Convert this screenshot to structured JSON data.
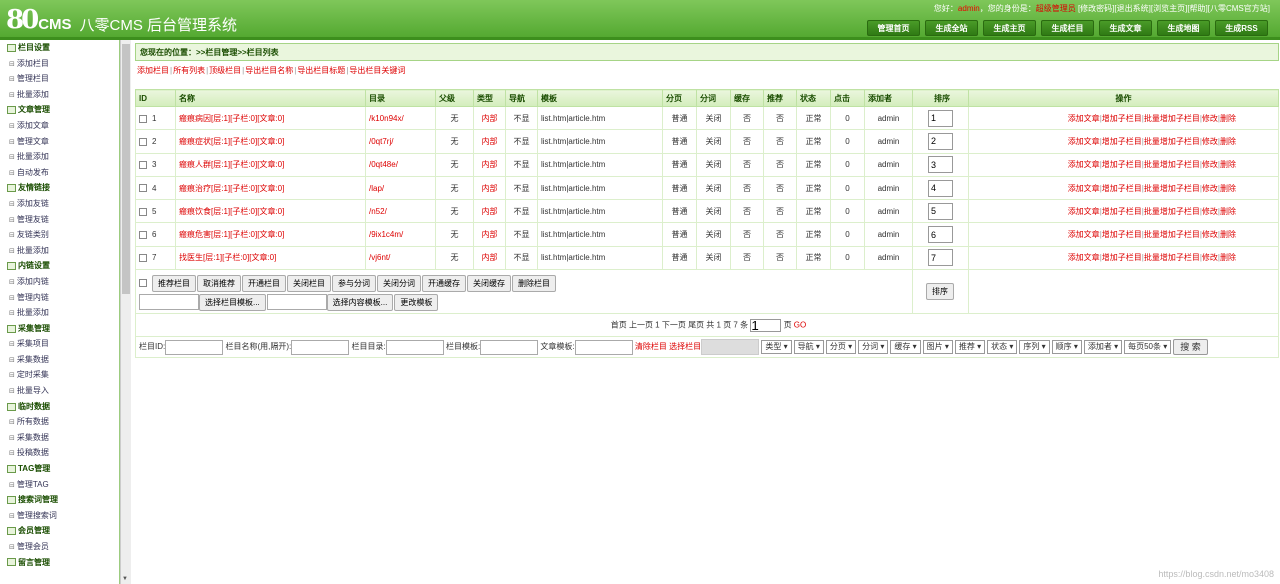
{
  "header": {
    "logo_mark": "80",
    "logo_cms": "CMS",
    "logo_title": "八零CMS 后台管理系统",
    "greeting": "您好：",
    "user": "admin",
    "identity_label": "，您的身份是：",
    "identity": "超级管理员",
    "links": [
      "[修改密码]",
      "[退出系统]",
      "[浏览主页]",
      "[帮助]",
      "[八零CMS官方站]"
    ],
    "nav": [
      "管理首页",
      "生成全站",
      "生成主页",
      "生成栏目",
      "生成文章",
      "生成地图",
      "生成RSS"
    ]
  },
  "sidebar": [
    {
      "group": "栏目设置",
      "items": [
        "添加栏目",
        "管理栏目",
        "批量添加"
      ]
    },
    {
      "group": "文章管理",
      "items": [
        "添加文章",
        "管理文章",
        "批量添加",
        "自动发布"
      ]
    },
    {
      "group": "友情链接",
      "items": [
        "添加友链",
        "管理友链",
        "友链类别",
        "批量添加"
      ]
    },
    {
      "group": "内链设置",
      "items": [
        "添加内链",
        "管理内链",
        "批量添加"
      ]
    },
    {
      "group": "采集管理",
      "items": [
        "采集项目",
        "采集数据",
        "定时采集",
        "批量导入"
      ]
    },
    {
      "group": "临时数据",
      "items": [
        "所有数据",
        "采集数据",
        "投稿数据"
      ]
    },
    {
      "group": "TAG管理",
      "items": [
        "管理TAG"
      ]
    },
    {
      "group": "搜索词管理",
      "items": [
        "管理搜索词"
      ]
    },
    {
      "group": "会员管理",
      "items": [
        "管理会员"
      ]
    },
    {
      "group": "留言管理",
      "items": []
    }
  ],
  "breadcrumb": "您现在的位置：>>栏目管理>>栏目列表",
  "actions": [
    "添加栏目",
    "所有列表",
    "顶级栏目",
    "导出栏目名称",
    "导出栏目标题",
    "导出栏目关键词"
  ],
  "table": {
    "headers": [
      "ID",
      "名称",
      "目录",
      "父级",
      "类型",
      "导航",
      "模板",
      "分页",
      "分词",
      "缓存",
      "推荐",
      "状态",
      "点击",
      "添加者",
      "排序",
      "操作"
    ],
    "rows": [
      {
        "id": "1",
        "name": "瘢痕病因",
        "meta": "[层:1][子栏:0][文章:0]",
        "dir": "/k10n94x/",
        "parent": "无",
        "type": "内部",
        "nav": "不显",
        "tpl": "list.htm|article.htm",
        "page": "普通",
        "split": "关闭",
        "cache": "否",
        "rec": "否",
        "status": "正常",
        "clicks": "0",
        "adder": "admin",
        "sort": "1"
      },
      {
        "id": "2",
        "name": "瘢痕症状",
        "meta": "[层:1][子栏:0][文章:0]",
        "dir": "/0qt7rj/",
        "parent": "无",
        "type": "内部",
        "nav": "不显",
        "tpl": "list.htm|article.htm",
        "page": "普通",
        "split": "关闭",
        "cache": "否",
        "rec": "否",
        "status": "正常",
        "clicks": "0",
        "adder": "admin",
        "sort": "2"
      },
      {
        "id": "3",
        "name": "瘢痕人群",
        "meta": "[层:1][子栏:0][文章:0]",
        "dir": "/0qt48e/",
        "parent": "无",
        "type": "内部",
        "nav": "不显",
        "tpl": "list.htm|article.htm",
        "page": "普通",
        "split": "关闭",
        "cache": "否",
        "rec": "否",
        "status": "正常",
        "clicks": "0",
        "adder": "admin",
        "sort": "3"
      },
      {
        "id": "4",
        "name": "瘢痕治疗",
        "meta": "[层:1][子栏:0][文章:0]",
        "dir": "/lap/",
        "parent": "无",
        "type": "内部",
        "nav": "不显",
        "tpl": "list.htm|article.htm",
        "page": "普通",
        "split": "关闭",
        "cache": "否",
        "rec": "否",
        "status": "正常",
        "clicks": "0",
        "adder": "admin",
        "sort": "4"
      },
      {
        "id": "5",
        "name": "瘢痕饮食",
        "meta": "[层:1][子栏:0][文章:0]",
        "dir": "/n52/",
        "parent": "无",
        "type": "内部",
        "nav": "不显",
        "tpl": "list.htm|article.htm",
        "page": "普通",
        "split": "关闭",
        "cache": "否",
        "rec": "否",
        "status": "正常",
        "clicks": "0",
        "adder": "admin",
        "sort": "5"
      },
      {
        "id": "6",
        "name": "瘢痕危害",
        "meta": "[层:1][子栏:0][文章:0]",
        "dir": "/9ix1c4m/",
        "parent": "无",
        "type": "内部",
        "nav": "不显",
        "tpl": "list.htm|article.htm",
        "page": "普通",
        "split": "关闭",
        "cache": "否",
        "rec": "否",
        "status": "正常",
        "clicks": "0",
        "adder": "admin",
        "sort": "6"
      },
      {
        "id": "7",
        "name": "找医生",
        "meta": "[层:1][子栏:0][文章:0]",
        "dir": "/vj6nt/",
        "parent": "无",
        "type": "内部",
        "nav": "不显",
        "tpl": "list.htm|article.htm",
        "page": "普通",
        "split": "关闭",
        "cache": "否",
        "rec": "否",
        "status": "正常",
        "clicks": "0",
        "adder": "admin",
        "sort": "7"
      }
    ],
    "ops": [
      "添加文章",
      "增加子栏目",
      "批量增加子栏目",
      "修改",
      "删除"
    ]
  },
  "batch": {
    "row1": [
      "推荐栏目",
      "取消推荐",
      "开通栏目",
      "关闭栏目",
      "参与分词",
      "关闭分词",
      "开通缓存",
      "关闭缓存",
      "删除栏目"
    ],
    "row2": [
      "选择栏目模板...",
      "选择内容模板...",
      "更改模板"
    ],
    "sort_button": "排序"
  },
  "pager": {
    "text": "首页 上一页 1 下一页 尾页 共 1 页 7 条",
    "page_input": "1",
    "after": "页",
    "go": "GO"
  },
  "filter": {
    "labels": [
      "栏目ID:",
      "栏目名称(用,隔开):",
      "栏目目录:",
      "栏目模板:",
      "文章模板:"
    ],
    "clear": "清除栏目",
    "choose": "选择栏目",
    "selects": [
      "类型",
      "导航",
      "分页",
      "分词",
      "缓存",
      "图片",
      "推荐",
      "状态",
      "序列",
      "顺序",
      "添加者",
      "每页50条"
    ],
    "search": "搜 索"
  },
  "watermark": "https://blog.csdn.net/mo3408"
}
